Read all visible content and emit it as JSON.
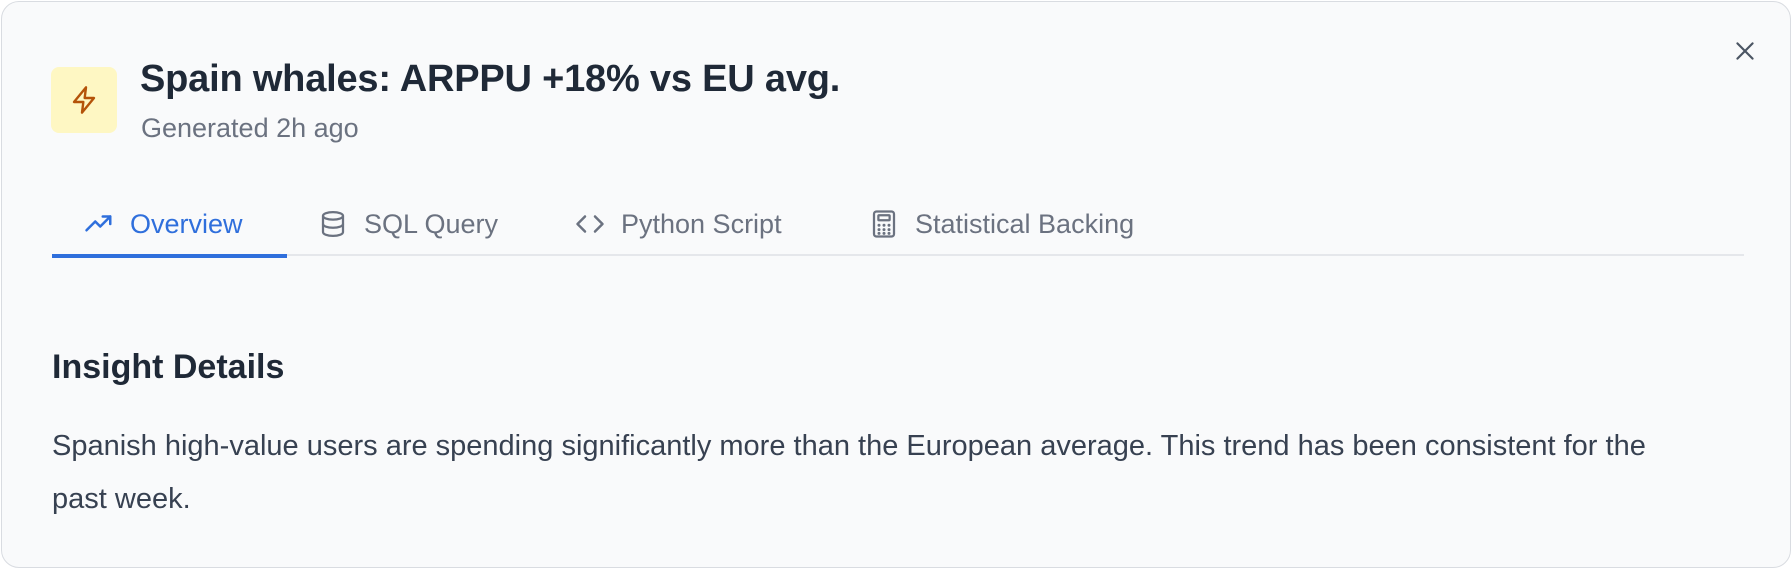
{
  "header": {
    "icon": "lightning-bolt-icon",
    "title": "Spain whales: ARPPU +18% vs EU avg.",
    "subtitle": "Generated 2h ago"
  },
  "close": {
    "icon": "close-icon"
  },
  "tabs": [
    {
      "label": "Overview",
      "icon": "trending-up-icon",
      "active": true
    },
    {
      "label": "SQL Query",
      "icon": "database-icon",
      "active": false
    },
    {
      "label": "Python Script",
      "icon": "code-icon",
      "active": false
    },
    {
      "label": "Statistical Backing",
      "icon": "calculator-icon",
      "active": false
    }
  ],
  "content": {
    "section_title": "Insight Details",
    "description": "Spanish high-value users are spending significantly more than the European average. This trend has been consistent for the past week."
  },
  "colors": {
    "accent": "#2f6fdc",
    "icon_bg": "#fef7c3",
    "icon_stroke": "#b45309",
    "muted_text": "#6b7280",
    "dialog_bg": "#f9fafb"
  }
}
